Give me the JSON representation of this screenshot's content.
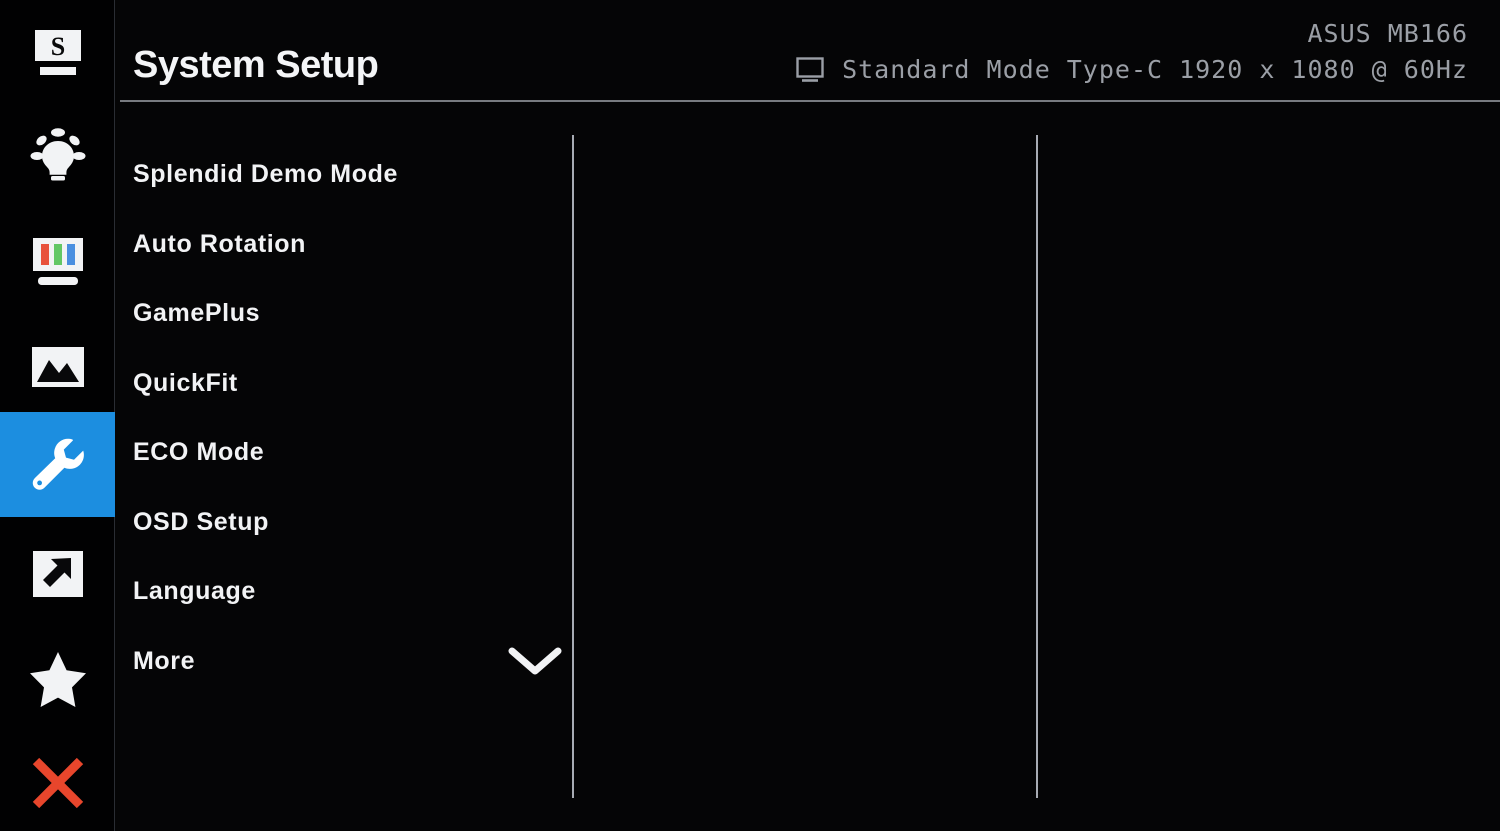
{
  "header": {
    "title": "System Setup",
    "model": "ASUS MB166",
    "monitor_icon": "monitor-icon",
    "preset_mode": "Standard Mode",
    "input_source": "Type-C",
    "resolution": "1920 x 1080 @ 60Hz"
  },
  "sidebar": {
    "items": [
      {
        "name": "splendid",
        "icon": "splendid-s-monitor-icon",
        "label": "Splendid",
        "selected": false
      },
      {
        "name": "bluelight",
        "icon": "lightbulb-icon",
        "label": "Blue Light Filter",
        "selected": false
      },
      {
        "name": "color",
        "icon": "rgb-color-bars-icon",
        "label": "Color",
        "selected": false
      },
      {
        "name": "image",
        "icon": "mountain-picture-icon",
        "label": "Image",
        "selected": false
      },
      {
        "name": "system-setup",
        "icon": "wrench-icon",
        "label": "System Setup",
        "selected": true
      },
      {
        "name": "shortcut",
        "icon": "diagonal-arrow-icon",
        "label": "Shortcut",
        "selected": false
      },
      {
        "name": "myfavorite",
        "icon": "star-icon",
        "label": "MyFavorite",
        "selected": false
      },
      {
        "name": "exit",
        "icon": "close-x-icon",
        "label": "Exit",
        "selected": false
      }
    ]
  },
  "menu": {
    "items": [
      {
        "label": "Splendid Demo Mode",
        "chevron": false
      },
      {
        "label": "Auto Rotation",
        "chevron": false
      },
      {
        "label": "GamePlus",
        "chevron": false
      },
      {
        "label": "QuickFit",
        "chevron": false
      },
      {
        "label": "ECO Mode",
        "chevron": false
      },
      {
        "label": "OSD Setup",
        "chevron": false
      },
      {
        "label": "Language",
        "chevron": false
      },
      {
        "label": "More",
        "chevron": true
      }
    ]
  },
  "colors": {
    "highlight_blue": "#1c8ee0",
    "exit_red": "#e8462c",
    "text_white": "#f2f3f5",
    "status_gray": "#9b9fa6",
    "divider_gray": "#b9bec6",
    "background": "#050506",
    "bar_red": "#e8523c",
    "bar_green": "#63c765",
    "bar_blue": "#4a8fe0"
  }
}
